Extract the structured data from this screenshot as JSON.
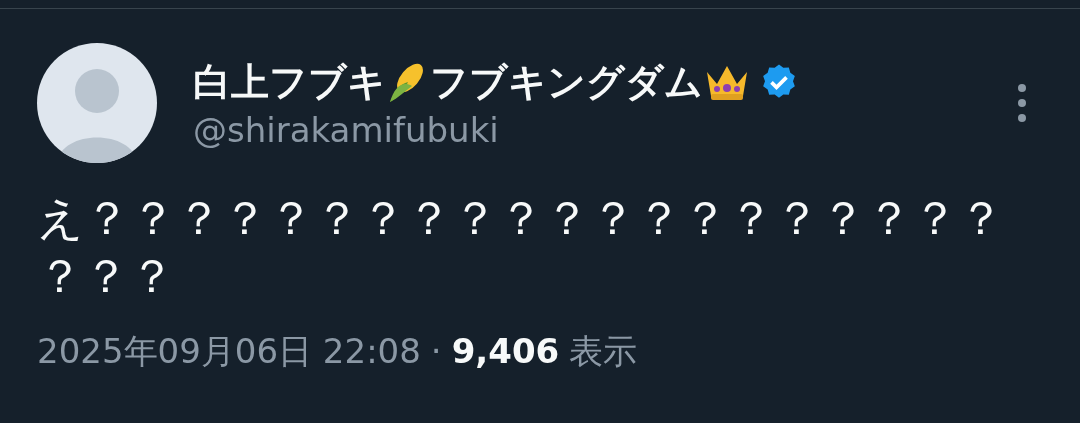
{
  "post": {
    "author": {
      "name_parts": [
        {
          "kind": "text",
          "text": "白上フブキ"
        },
        {
          "kind": "corn"
        },
        {
          "kind": "text",
          "text": "フブキングダム"
        },
        {
          "kind": "crown"
        }
      ],
      "verified": true,
      "handle": "@shirakamifubuki"
    },
    "text": "え？？？？？？？？？？？？？？？？？？？？？？？",
    "timestamp": "2025年09月06日 22:08",
    "separator": "·",
    "views": "9,406",
    "views_label": "表示"
  }
}
